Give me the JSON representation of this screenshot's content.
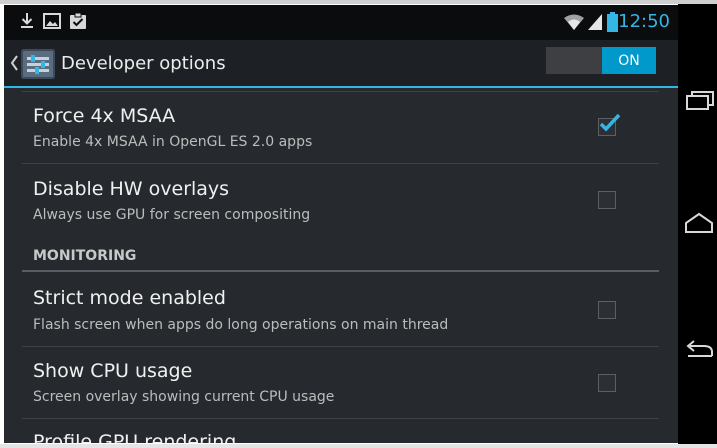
{
  "status_bar": {
    "time": "12:50",
    "left_icons": [
      "download-icon",
      "image-icon",
      "clipboard-check-icon"
    ],
    "right_icons": [
      "wifi-icon",
      "signal-icon",
      "battery-icon"
    ],
    "accent_color": "#33b5e5"
  },
  "action_bar": {
    "title": "Developer options",
    "toggle": {
      "label": "ON",
      "state": "on"
    }
  },
  "settings": [
    {
      "title": "Force 4x MSAA",
      "subtitle": "Enable 4x MSAA in OpenGL ES 2.0 apps",
      "checked": true
    },
    {
      "title": "Disable HW overlays",
      "subtitle": "Always use GPU for screen compositing",
      "checked": false
    }
  ],
  "section": {
    "header": "MONITORING"
  },
  "monitoring_settings": [
    {
      "title": "Strict mode enabled",
      "subtitle": "Flash screen when apps do long operations on main thread",
      "checked": false
    },
    {
      "title": "Show CPU usage",
      "subtitle": "Screen overlay showing current CPU usage",
      "checked": false
    }
  ],
  "cut_off_item": {
    "title": "Profile GPU rendering"
  },
  "nav_bar": {
    "buttons": [
      "recent-apps-icon",
      "home-icon",
      "back-icon"
    ]
  },
  "colors": {
    "background": "#262a2e",
    "checkbox_check": "#33b5e5"
  }
}
